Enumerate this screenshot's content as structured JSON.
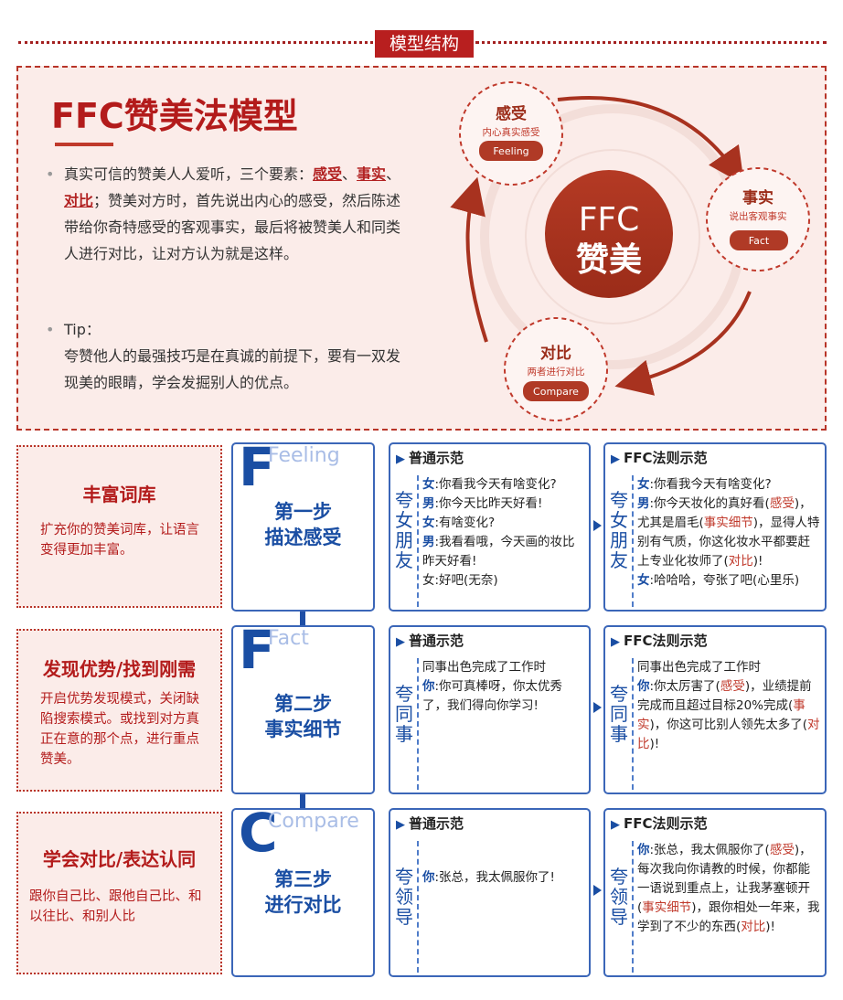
{
  "header": {
    "title": "模型结构"
  },
  "intro": {
    "title": "FFC赞美法模型",
    "bullet1_pre": "真实可信的赞美人人爱听，三个要素：",
    "bullet1_k1": "感受",
    "bullet1_sep1": "、",
    "bullet1_k2": "事实",
    "bullet1_sep2": "、",
    "bullet1_k3": "对比",
    "bullet1_post": "；赞美对方时，首先说出内心的感受，然后陈述带给你奇特感受的客观事实，最后将被赞美人和同类人进行对比，让对方认为就是这样。",
    "tip_label": "Tip：",
    "tip_text": "夸赞他人的最强技巧是在真诚的前提下，要有一双发现美的眼睛，学会发掘别人的优点。"
  },
  "cycle": {
    "center_line1": "FFC",
    "center_line2": "赞美",
    "nodes": [
      {
        "title": "感受",
        "sub": "内心真实感受",
        "pill": "Feeling"
      },
      {
        "title": "事实",
        "sub": "说出客观事实",
        "pill": "Fact"
      },
      {
        "title": "对比",
        "sub": "两者进行对比",
        "pill": "Compare"
      }
    ],
    "colors": {
      "dark_red": "#a8321f",
      "pill_red": "#c0392b",
      "ring": "#e8c9c2"
    }
  },
  "rows": [
    {
      "side_title": "丰富词库",
      "side_desc": "扩充你的赞美词库，让语言变得更加丰富。",
      "letter": "F",
      "word": "Feeling",
      "step_line1": "第一步",
      "step_line2": "描述感受",
      "normal": {
        "head": "普通示范",
        "vert": [
          "夸",
          "女",
          "朋",
          "友"
        ],
        "lines": [
          {
            "who": "女",
            "text": ":你看我今天有啥变化?"
          },
          {
            "who": "男",
            "text": ":你今天比昨天好看!"
          },
          {
            "who": "女",
            "text": ":有啥变化?"
          },
          {
            "who": "男",
            "text": ":我看看哦，今天画的妆比昨天好看!"
          },
          {
            "who": "",
            "text": "女:好吧(无奈)"
          }
        ]
      },
      "ffc": {
        "head": "FFC法则示范",
        "vert": [
          "夸",
          "女",
          "朋",
          "友"
        ]
      }
    },
    {
      "side_title": "发现优势/找到刚需",
      "side_desc": "开启优势发现模式，关闭缺陷搜索模式。或找到对方真正在意的那个点，进行重点赞美。",
      "letter": "F",
      "word": "Fact",
      "step_line1": "第二步",
      "step_line2": "事实细节",
      "normal": {
        "head": "普通示范",
        "vert": [
          "夸",
          "同",
          "事"
        ],
        "intro": "同事出色完成了工作时",
        "who": "你",
        "text": ":你可真棒呀，你太优秀了，我们得向你学习!"
      },
      "ffc": {
        "head": "FFC法则示范",
        "vert": [
          "夸",
          "同",
          "事"
        ],
        "intro": "同事出色完成了工作时"
      }
    },
    {
      "side_title": "学会对比/表达认同",
      "side_desc": "跟你自己比、跟他自己比、和以往比、和别人比",
      "letter": "C",
      "word": "Compare",
      "step_line1": "第三步",
      "step_line2": "进行对比",
      "normal": {
        "head": "普通示范",
        "vert": [
          "夸",
          "领",
          "导"
        ],
        "who": "你",
        "text": ":张总，我太佩服你了!"
      },
      "ffc": {
        "head": "FFC法则示范",
        "vert": [
          "夸",
          "领",
          "导"
        ]
      }
    }
  ],
  "ffc1": {
    "l1_who": "女",
    "l1_text": ":你看我今天有啥变化?",
    "l2_who": "男",
    "l2_a": ":你今天妆化的真好看(",
    "l2_red1": "感受",
    "l2_b": ")，尤其是眉毛(",
    "l2_red2": "事实细节",
    "l2_c": ")，显得人特别有气质，你这化妆水平都要赶上专业化妆师了(",
    "l2_red3": "对比",
    "l2_d": ")!",
    "l3_who": "女",
    "l3_text": ":哈哈哈，夸张了吧(心里乐)"
  },
  "ffc2": {
    "who": "你",
    "a": ":你太厉害了(",
    "red1": "感受",
    "b": ")，业绩提前完成而且超过目标20%完成(",
    "red2": "事实",
    "c": ")，你这可比别人领先太多了(",
    "red3": "对比",
    "d": ")!"
  },
  "ffc3": {
    "who": "你",
    "a": ":张总，我太佩服你了(",
    "red1": "感受",
    "b": ")，每次我向你请教的时候，你都能一语说到重点上，让我茅塞顿开(",
    "red2": "事实细节",
    "c": ")，跟你相处一年来，我学到了不少的东西(",
    "red3": "对比",
    "d": ")!"
  }
}
